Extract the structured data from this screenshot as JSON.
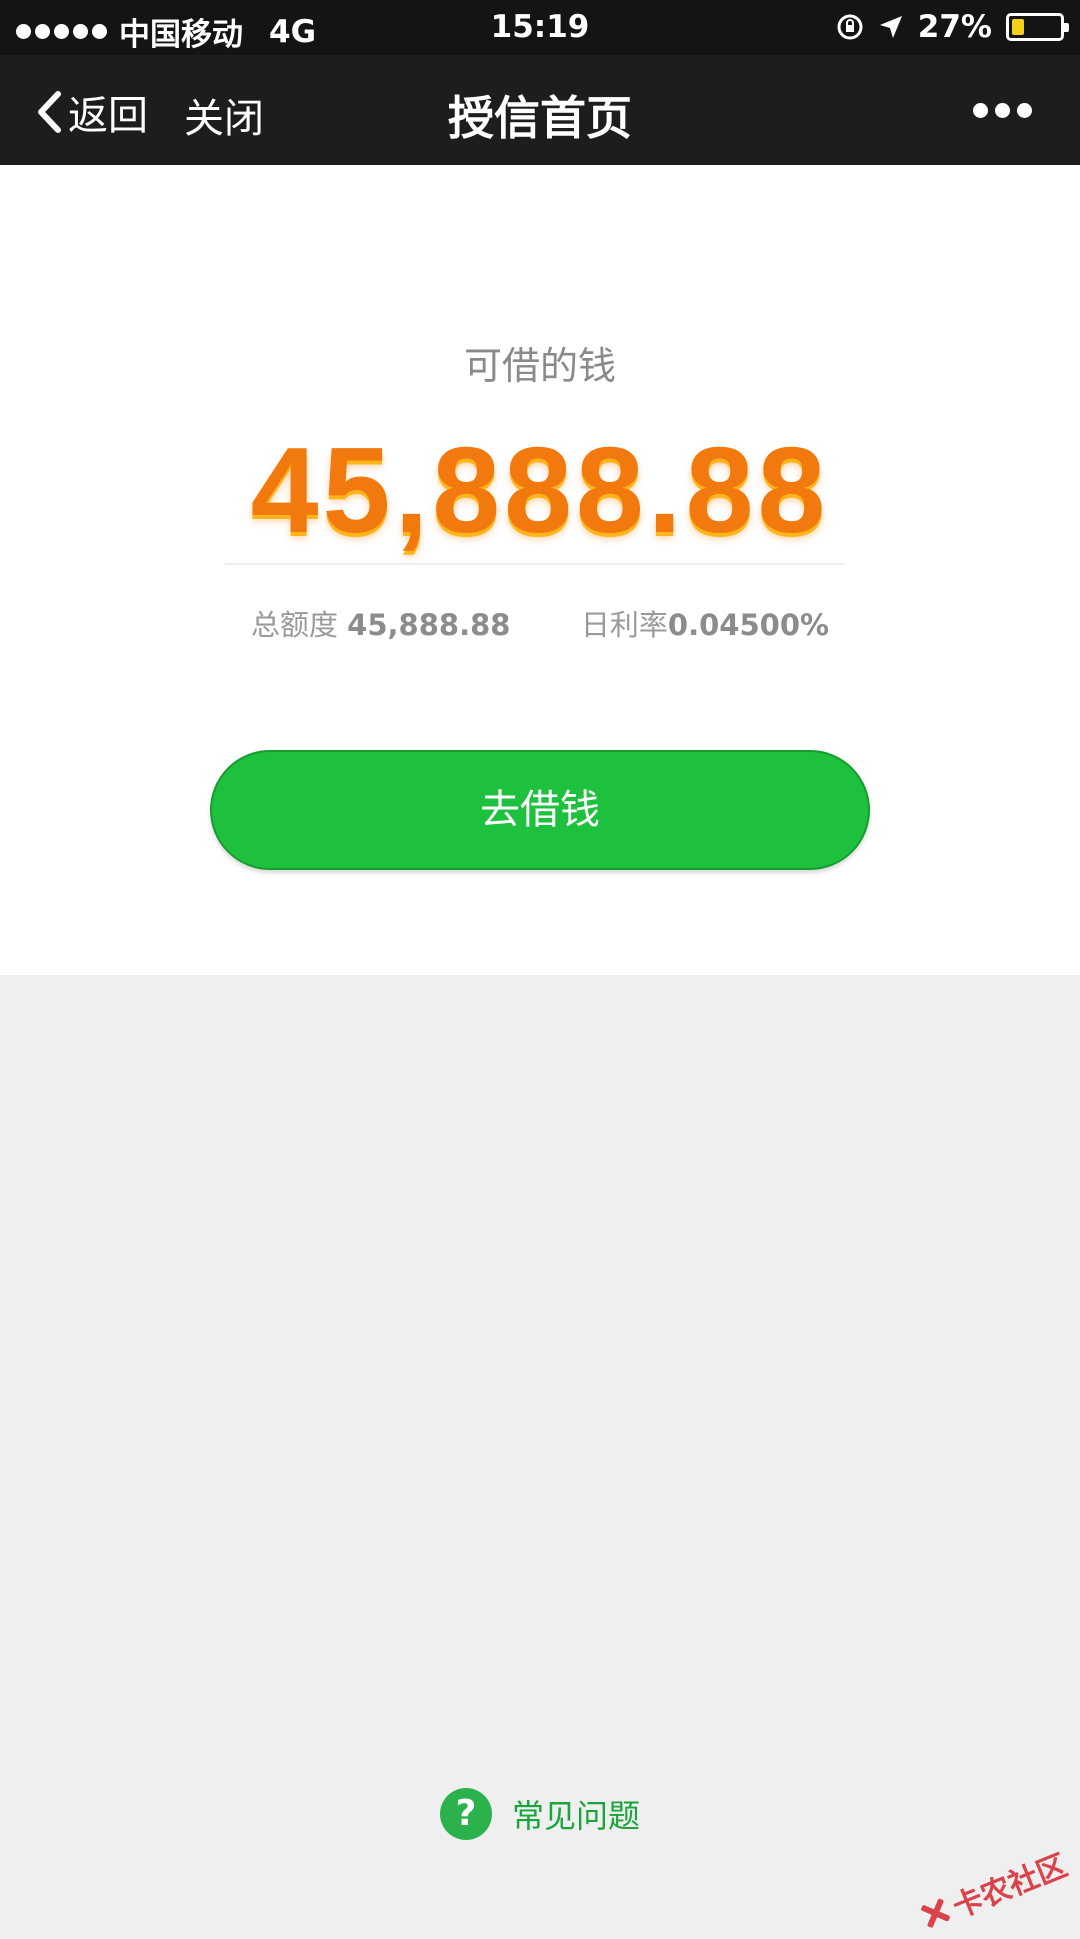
{
  "status_bar": {
    "carrier": "中国移动",
    "network": "4G",
    "time": "15:19",
    "battery_percent": "27%",
    "battery_level": 0.27,
    "battery_color": "#f3d11a"
  },
  "nav": {
    "back_label": "返回",
    "close_label": "关闭",
    "title": "授信首页"
  },
  "credit": {
    "available_label": "可借的钱",
    "available_amount": "45,888.88",
    "total_label": "总额度",
    "total_value": "45,888.88",
    "rate_label": "日利率",
    "rate_value": "0.04500%"
  },
  "actions": {
    "borrow_label": "去借钱"
  },
  "footer": {
    "faq_icon": "?",
    "faq_label": "常见问题"
  },
  "watermark": {
    "text": "卡农社区"
  },
  "colors": {
    "accent_green": "#1ec13d",
    "amount_orange": "#f2790d"
  }
}
